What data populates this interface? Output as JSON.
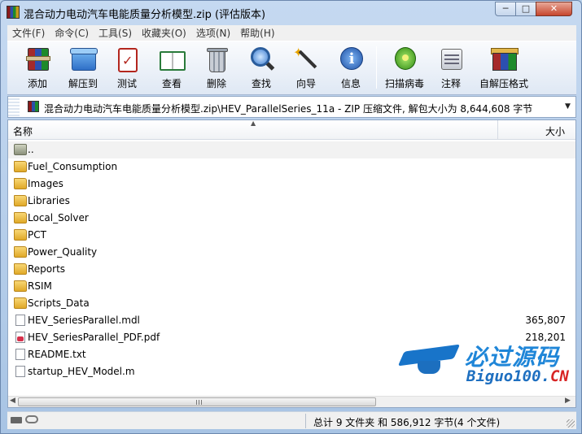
{
  "window": {
    "title": "混合动力电动汽车电能质量分析模型.zip (评估版本)",
    "controls": {
      "minimize": "─",
      "maximize": "□",
      "close": "✕"
    }
  },
  "menu": [
    "文件(F)",
    "命令(C)",
    "工具(S)",
    "收藏夹(O)",
    "选项(N)",
    "帮助(H)"
  ],
  "toolbar": {
    "add": "添加",
    "extract": "解压到",
    "test": "测试",
    "view": "查看",
    "delete": "删除",
    "find": "查找",
    "wizard": "向导",
    "info": "信息",
    "virus_scan": "扫描病毒",
    "comment": "注释",
    "sfx": "自解压格式"
  },
  "address": {
    "path": "混合动力电动汽车电能质量分析模型.zip\\HEV_ParallelSeries_11a - ZIP 压缩文件, 解包大小为 8,644,608 字节"
  },
  "columns": {
    "name": "名称",
    "size": "大小"
  },
  "files": [
    {
      "name": "..",
      "size": "",
      "type": "up"
    },
    {
      "name": "Fuel_Consumption",
      "size": "",
      "type": "folder"
    },
    {
      "name": "Images",
      "size": "",
      "type": "folder"
    },
    {
      "name": "Libraries",
      "size": "",
      "type": "folder"
    },
    {
      "name": "Local_Solver",
      "size": "",
      "type": "folder"
    },
    {
      "name": "PCT",
      "size": "",
      "type": "folder"
    },
    {
      "name": "Power_Quality",
      "size": "",
      "type": "folder"
    },
    {
      "name": "Reports",
      "size": "",
      "type": "folder"
    },
    {
      "name": "RSIM",
      "size": "",
      "type": "folder"
    },
    {
      "name": "Scripts_Data",
      "size": "",
      "type": "folder"
    },
    {
      "name": "HEV_SeriesParallel.mdl",
      "size": "365,807",
      "type": "file"
    },
    {
      "name": "HEV_SeriesParallel_PDF.pdf",
      "size": "218,201",
      "type": "pdf"
    },
    {
      "name": "README.txt",
      "size": "",
      "type": "file"
    },
    {
      "name": "startup_HEV_Model.m",
      "size": "",
      "type": "file"
    }
  ],
  "watermark": {
    "cn": "必过源码",
    "en": "Biguo100.",
    "en_suffix": "CN"
  },
  "status": {
    "text": "总计 9 文件夹 和 586,912 字节(4 个文件)"
  }
}
